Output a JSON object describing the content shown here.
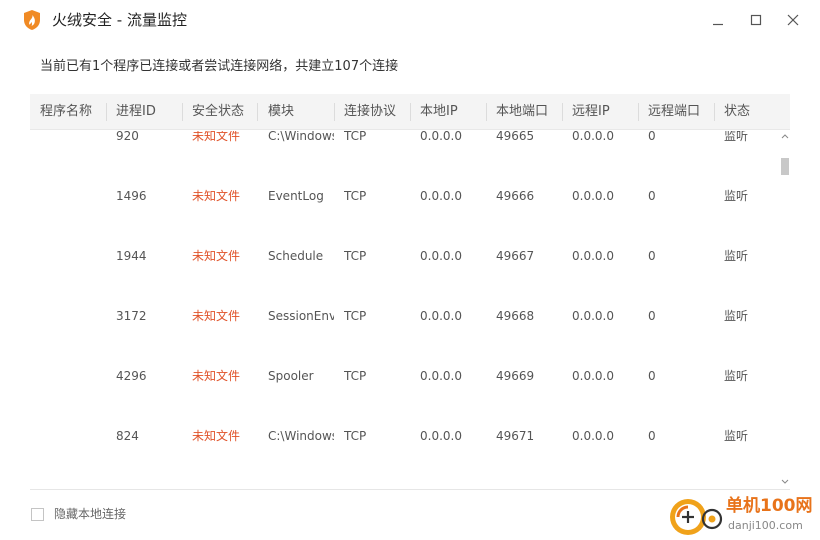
{
  "window": {
    "title": "火绒安全 - 流量监控",
    "accent_color": "#f08a24",
    "controls": {
      "minimize_icon": "minimize-icon",
      "maximize_icon": "maximize-icon",
      "close_icon": "close-icon"
    }
  },
  "summary": "当前已有1个程序已连接或者尝试连接网络，共建立107个连接",
  "table": {
    "columns": [
      "程序名称",
      "进程ID",
      "安全状态",
      "模块",
      "连接协议",
      "本地IP",
      "本地端口",
      "远程IP",
      "远程端口",
      "状态"
    ],
    "rows": [
      {
        "name": "",
        "pid": "920",
        "security": "未知文件",
        "module": "C:\\Windows",
        "protocol": "TCP",
        "local_ip": "0.0.0.0",
        "local_port": "49665",
        "remote_ip": "0.0.0.0",
        "remote_port": "0",
        "state": "监听"
      },
      {
        "name": "",
        "pid": "1496",
        "security": "未知文件",
        "module": "EventLog",
        "protocol": "TCP",
        "local_ip": "0.0.0.0",
        "local_port": "49666",
        "remote_ip": "0.0.0.0",
        "remote_port": "0",
        "state": "监听"
      },
      {
        "name": "",
        "pid": "1944",
        "security": "未知文件",
        "module": "Schedule",
        "protocol": "TCP",
        "local_ip": "0.0.0.0",
        "local_port": "49667",
        "remote_ip": "0.0.0.0",
        "remote_port": "0",
        "state": "监听"
      },
      {
        "name": "",
        "pid": "3172",
        "security": "未知文件",
        "module": "SessionEnv",
        "protocol": "TCP",
        "local_ip": "0.0.0.0",
        "local_port": "49668",
        "remote_ip": "0.0.0.0",
        "remote_port": "0",
        "state": "监听"
      },
      {
        "name": "",
        "pid": "4296",
        "security": "未知文件",
        "module": "Spooler",
        "protocol": "TCP",
        "local_ip": "0.0.0.0",
        "local_port": "49669",
        "remote_ip": "0.0.0.0",
        "remote_port": "0",
        "state": "监听"
      },
      {
        "name": "",
        "pid": "824",
        "security": "未知文件",
        "module": "C:\\Windows",
        "protocol": "TCP",
        "local_ip": "0.0.0.0",
        "local_port": "49671",
        "remote_ip": "0.0.0.0",
        "remote_port": "0",
        "state": "监听"
      }
    ],
    "security_color": "#e0532a"
  },
  "footer": {
    "hide_local_label": "隐藏本地连接",
    "hide_local_checked": false
  },
  "watermark": {
    "brand": "单机100网",
    "url": "danji100.com"
  }
}
